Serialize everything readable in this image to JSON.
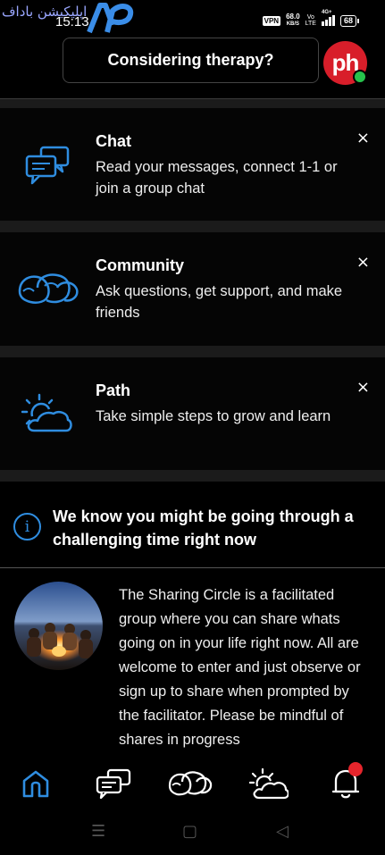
{
  "status_bar": {
    "time": "15:13",
    "vpn": "VPN",
    "speed_value": "68.0",
    "speed_unit": "KB/S",
    "lte_top": "Vo",
    "lte_bottom": "LTE",
    "network": "4G+",
    "battery": "68"
  },
  "watermark": {
    "text": "اپلیکیشن باداف",
    "icon": "ap-logo-icon"
  },
  "header": {
    "therapy_button_label": "Considering therapy?",
    "avatar_initials": "ph",
    "online_status_color": "#27c24c",
    "avatar_color": "#d81e2a"
  },
  "cards": [
    {
      "title": "Chat",
      "description": "Read your messages, connect 1-1 or join a group chat",
      "icon": "chat-bubbles-icon",
      "close": "×"
    },
    {
      "title": "Community",
      "description": "Ask questions, get support, and make friends",
      "icon": "community-faces-icon",
      "close": "×"
    },
    {
      "title": "Path",
      "description": "Take simple steps to grow and learn",
      "icon": "sun-cloud-icon",
      "close": "×"
    }
  ],
  "info_banner": {
    "icon_glyph": "i",
    "text": "We know you might be going through a challenging time right now"
  },
  "sharing_circle": {
    "image": "campfire-group-photo",
    "text": "The Sharing Circle is a facilitated group where you can share whats going on in your life right now. All are welcome to enter and just observe or sign up to share when prompted by the facilitator. Please be mindful of shares in progress"
  },
  "bottom_nav": {
    "items": [
      "home-icon",
      "chat-icon",
      "community-icon",
      "path-icon",
      "notifications-icon"
    ],
    "active_color": "#2f8de0",
    "notification_badge_color": "#e5252c"
  },
  "system_nav": {
    "menu": "☰",
    "home": "▢",
    "back": "◁"
  },
  "colors": {
    "accent": "#2f8de0",
    "background": "#000000",
    "section_gap": "#1b1b1b"
  }
}
